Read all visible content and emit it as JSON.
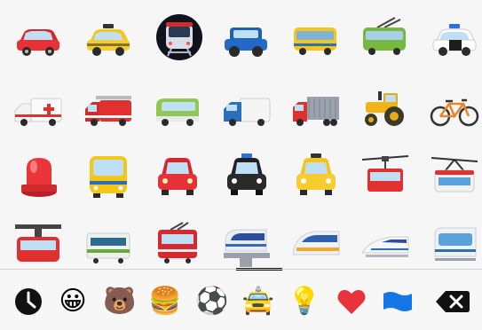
{
  "emoji_grid": {
    "rows": [
      [
        {
          "name": "red-car"
        },
        {
          "name": "taxi"
        },
        {
          "name": "metro-train-front"
        },
        {
          "name": "blue-suv"
        },
        {
          "name": "bus"
        },
        {
          "name": "trolleybus"
        },
        {
          "name": "police-car"
        }
      ],
      [
        {
          "name": "ambulance"
        },
        {
          "name": "fire-engine"
        },
        {
          "name": "minibus"
        },
        {
          "name": "delivery-truck"
        },
        {
          "name": "articulated-lorry"
        },
        {
          "name": "tractor"
        },
        {
          "name": "bicycle"
        }
      ],
      [
        {
          "name": "police-light"
        },
        {
          "name": "oncoming-bus"
        },
        {
          "name": "oncoming-car"
        },
        {
          "name": "oncoming-police-car"
        },
        {
          "name": "oncoming-taxi"
        },
        {
          "name": "aerial-tramway"
        },
        {
          "name": "mountain-cableway"
        }
      ],
      [
        {
          "name": "suspension-railway"
        },
        {
          "name": "railway-car"
        },
        {
          "name": "tram"
        },
        {
          "name": "monorail"
        },
        {
          "name": "high-speed-train"
        },
        {
          "name": "bullet-train"
        },
        {
          "name": "light-rail"
        }
      ]
    ]
  },
  "category_bar": {
    "items": [
      {
        "name": "recent",
        "glyph": ""
      },
      {
        "name": "smileys",
        "glyph": "😀"
      },
      {
        "name": "animals",
        "glyph": "🐻"
      },
      {
        "name": "food",
        "glyph": "🍔"
      },
      {
        "name": "activity",
        "glyph": "⚽"
      },
      {
        "name": "travel",
        "glyph": "🚖"
      },
      {
        "name": "objects",
        "glyph": "💡"
      },
      {
        "name": "symbols",
        "glyph": "❤"
      },
      {
        "name": "flags",
        "glyph": ""
      },
      {
        "name": "delete",
        "glyph": ""
      }
    ]
  },
  "colors": {
    "background": "#f6f6f6",
    "indicator": "#111111",
    "heart": "#e8333c",
    "flag": "#1577e6"
  }
}
